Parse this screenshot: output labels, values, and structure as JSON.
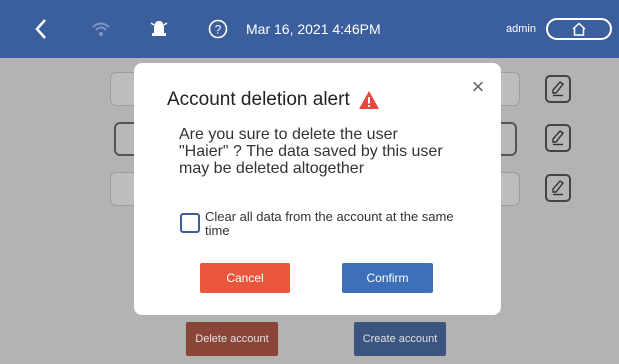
{
  "topbar": {
    "datetime": "Mar 16, 2021 4:46PM",
    "user": "admin",
    "back_icon": "chevron-left-icon",
    "wifi_icon": "wifi-icon",
    "alarm_icon": "alarm-icon",
    "help_icon": "help-icon",
    "home_icon": "home-icon"
  },
  "background_buttons": {
    "delete_label": "Delete account",
    "create_label": "Create account"
  },
  "modal": {
    "title": "Account deletion alert",
    "warning_icon": "warning-icon",
    "message": "Are you sure to delete the user \"Haier\" ? The data saved by this user may be deleted altogether",
    "checkbox_label": "Clear all data from the account at the same time",
    "cancel_label": "Cancel",
    "confirm_label": "Confirm"
  },
  "colors": {
    "header": "#3b5e9c",
    "cancel": "#e8573d",
    "confirm": "#3e6fb8",
    "warning": "#e8473d"
  }
}
